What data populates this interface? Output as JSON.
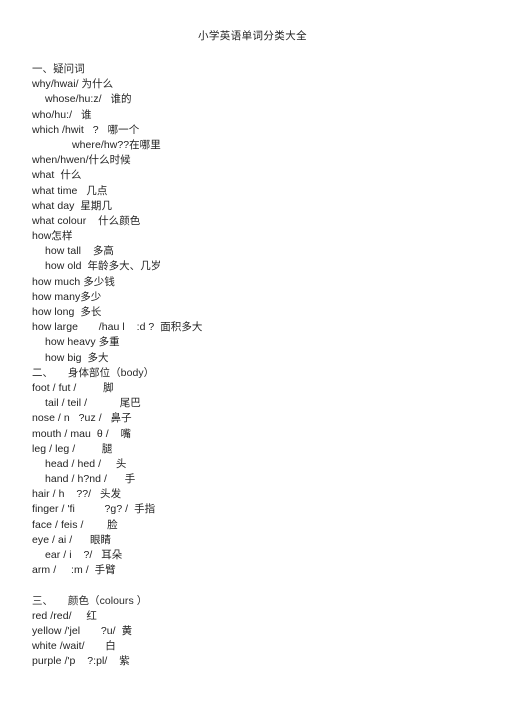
{
  "document": {
    "title": "小学英语单词分类大全",
    "background_color": "#ffffff",
    "text_color": "#1f1f1f"
  },
  "sections": [
    {
      "heading": "一、疑问词",
      "heading_indent": 0,
      "lines": [
        {
          "text": "why/hwai/ 为什么",
          "indent": 0
        },
        {
          "text": "whose/hu:z/   谁的",
          "indent": 1
        },
        {
          "text": "who/hu:/   谁",
          "indent": 0
        },
        {
          "text": "which /hwit   ?   哪一个",
          "indent": 0
        },
        {
          "text": "where/hw??在哪里",
          "indent": 2
        },
        {
          "text": "when/hwen/什么时候",
          "indent": 0
        },
        {
          "text": "what  什么",
          "indent": 0
        },
        {
          "text": "what time   几点",
          "indent": 0
        },
        {
          "text": "what day  星期几",
          "indent": 0
        },
        {
          "text": "what colour    什么颜色",
          "indent": 0
        },
        {
          "text": "how怎样",
          "indent": 0
        },
        {
          "text": "how tall    多高",
          "indent": 1
        },
        {
          "text": "how old  年龄多大、几岁",
          "indent": 1
        },
        {
          "text": "how much 多少钱",
          "indent": 0
        },
        {
          "text": "how many多少",
          "indent": 0
        },
        {
          "text": "how long  多长",
          "indent": 0
        },
        {
          "text": "how large       /hau l    :d ?  面积多大",
          "indent": 0
        },
        {
          "text": "how heavy 多重",
          "indent": 1
        },
        {
          "text": "how big  多大",
          "indent": 1
        }
      ]
    },
    {
      "heading": "二、     身体部位（body）",
      "heading_indent": 0,
      "lines": [
        {
          "text": "foot / fut /         脚",
          "indent": 0
        },
        {
          "text": "tail / teil /           尾巴",
          "indent": 1
        },
        {
          "text": "nose / n   ?uz /   鼻子",
          "indent": 0
        },
        {
          "text": "mouth / mau  θ /    嘴",
          "indent": 0
        },
        {
          "text": "leg / leg /         腿",
          "indent": 0
        },
        {
          "text": "head / hed /     头",
          "indent": 1
        },
        {
          "text": "hand / h?nd /      手",
          "indent": 1
        },
        {
          "text": "hair / h    ??/   头发",
          "indent": 0
        },
        {
          "text": "finger / 'fi          ?g? /  手指",
          "indent": 0
        },
        {
          "text": "face / feis /        脸",
          "indent": 0
        },
        {
          "text": "eye / ai /      眼睛",
          "indent": 0
        },
        {
          "text": "ear / i    ?/   耳朵",
          "indent": 1
        },
        {
          "text": "arm /     :m /  手臂",
          "indent": 0
        }
      ]
    },
    {
      "heading": "三、     颜色（colours ）",
      "heading_indent": 0,
      "blank_before": true,
      "lines": [
        {
          "text": "red /red/     红",
          "indent": 0
        },
        {
          "text": "yellow /'jel       ?u/  黄",
          "indent": 0
        },
        {
          "text": "white /wait/       白",
          "indent": 0
        },
        {
          "text": "purple /'p    ?:pl/    紫",
          "indent": 0
        }
      ]
    }
  ]
}
